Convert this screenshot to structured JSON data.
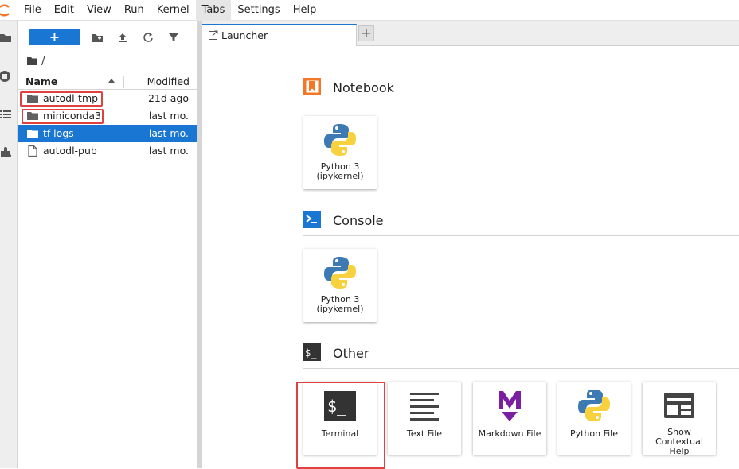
{
  "menu": {
    "items": [
      "File",
      "Edit",
      "View",
      "Run",
      "Kernel",
      "Tabs",
      "Settings",
      "Help"
    ],
    "active": "Tabs"
  },
  "filebrowser": {
    "new_label": "+",
    "breadcrumb": "/",
    "header_name": "Name",
    "header_modified": "Modified",
    "rows": [
      {
        "name": "autodl-tmp",
        "modified": "21d ago",
        "type": "folder"
      },
      {
        "name": "miniconda3",
        "modified": "last mo.",
        "type": "folder"
      },
      {
        "name": "tf-logs",
        "modified": "last mo.",
        "type": "folder"
      },
      {
        "name": "autodl-pub",
        "modified": "last mo.",
        "type": "file"
      }
    ]
  },
  "tabs": {
    "active_label": "Launcher",
    "add_label": "+"
  },
  "launcher": {
    "sections": {
      "notebook": "Notebook",
      "console": "Console",
      "other": "Other"
    },
    "notebook_card": {
      "line1": "Python 3",
      "line2": "(ipykernel)"
    },
    "console_card": {
      "line1": "Python 3",
      "line2": "(ipykernel)"
    },
    "other_cards": {
      "terminal": "Terminal",
      "textfile": "Text File",
      "markdown": "Markdown File",
      "python": "Python File",
      "help1": "Show",
      "help2": "Contextual",
      "help3": "Help"
    }
  },
  "colors": {
    "accent": "#1976d2",
    "highlight": "#e04040",
    "notebook": "#f37726",
    "markdown": "#7b1fa2"
  }
}
